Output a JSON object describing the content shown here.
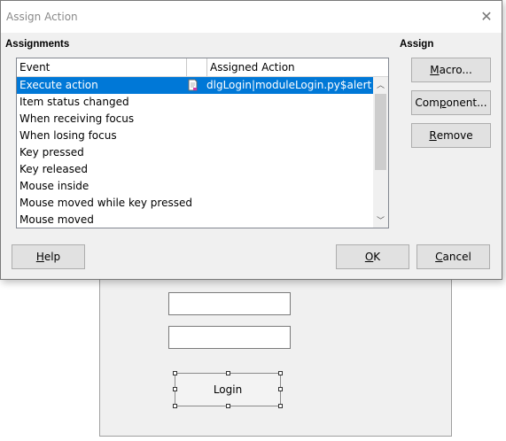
{
  "dialog": {
    "title": "Assign Action",
    "assignments_label": "Assignments",
    "assign_label": "Assign"
  },
  "table": {
    "headers": {
      "event": "Event",
      "assigned_action": "Assigned Action"
    },
    "rows": [
      {
        "event": "Execute action",
        "action": "dlgLogin|moduleLogin.py$alert",
        "selected": true
      },
      {
        "event": "Item status changed",
        "action": ""
      },
      {
        "event": "When receiving focus",
        "action": ""
      },
      {
        "event": "When losing focus",
        "action": ""
      },
      {
        "event": "Key pressed",
        "action": ""
      },
      {
        "event": "Key released",
        "action": ""
      },
      {
        "event": "Mouse inside",
        "action": ""
      },
      {
        "event": "Mouse moved while key pressed",
        "action": ""
      },
      {
        "event": "Mouse moved",
        "action": ""
      }
    ]
  },
  "buttons": {
    "macro": {
      "accel": "M",
      "rest": "acro..."
    },
    "component": {
      "accel": "",
      "pre": "Com",
      "mid": "p",
      "post": "onent..."
    },
    "remove": {
      "accel": "R",
      "rest": "emove"
    },
    "help": {
      "accel": "H",
      "rest": "elp"
    },
    "ok": {
      "accel": "O",
      "rest": "K"
    },
    "cancel": {
      "accel": "C",
      "rest": "ancel"
    }
  },
  "background_form": {
    "login_button": "Login"
  },
  "colors": {
    "selection": "#0078d7",
    "dialog_bg": "#f0f0f0"
  }
}
